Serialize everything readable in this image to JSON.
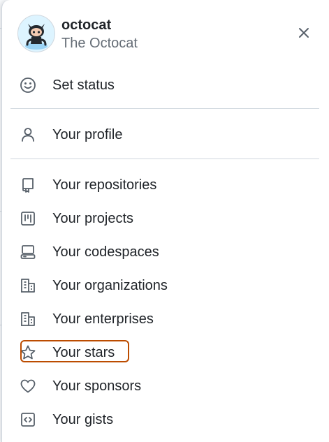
{
  "user": {
    "login": "octocat",
    "name": "The Octocat",
    "avatar_icon": "octocat-avatar"
  },
  "header": {
    "close_icon": "close-icon"
  },
  "menu": {
    "status": {
      "label": "Set status",
      "icon": "smiley-icon"
    },
    "profile": {
      "label": "Your profile",
      "icon": "person-icon"
    },
    "repositories": {
      "label": "Your repositories",
      "icon": "repo-icon"
    },
    "projects": {
      "label": "Your projects",
      "icon": "project-icon"
    },
    "codespaces": {
      "label": "Your codespaces",
      "icon": "codespaces-icon"
    },
    "organizations": {
      "label": "Your organizations",
      "icon": "organization-icon"
    },
    "enterprises": {
      "label": "Your enterprises",
      "icon": "enterprise-icon"
    },
    "stars": {
      "label": "Your stars",
      "icon": "star-icon",
      "highlighted": true
    },
    "sponsors": {
      "label": "Your sponsors",
      "icon": "heart-icon"
    },
    "gists": {
      "label": "Your gists",
      "icon": "code-square-icon"
    }
  },
  "colors": {
    "text_primary": "#1f2328",
    "text_muted": "#656d76",
    "border": "#d0d7de",
    "highlight": "#bc4c00"
  }
}
